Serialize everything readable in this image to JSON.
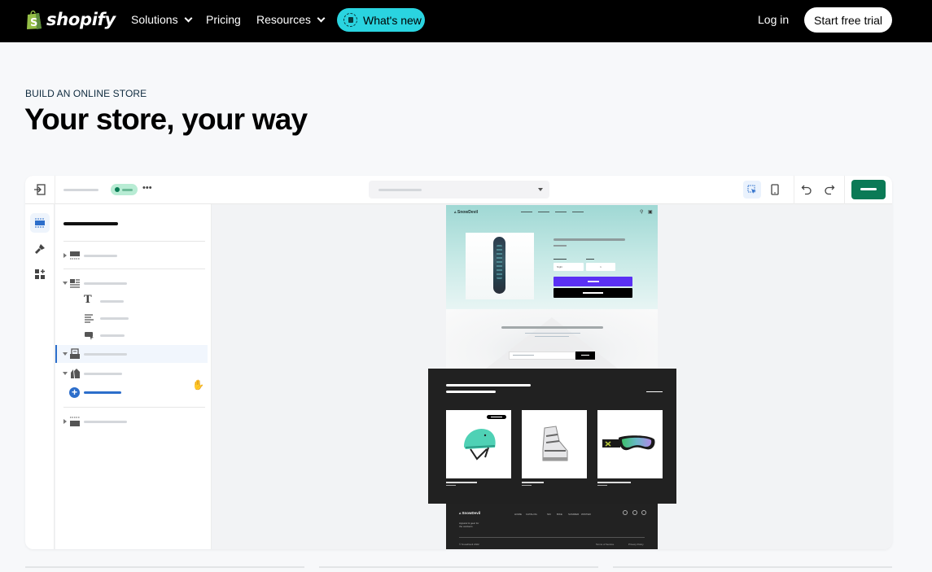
{
  "nav": {
    "brand": "shopify",
    "items": [
      {
        "label": "Solutions",
        "has_dropdown": true
      },
      {
        "label": "Pricing",
        "has_dropdown": false
      },
      {
        "label": "Resources",
        "has_dropdown": true
      }
    ],
    "whats_new": "What's new",
    "login": "Log in",
    "cta": "Start free trial"
  },
  "hero": {
    "eyebrow": "BUILD AN ONLINE STORE",
    "headline": "Your store, your way"
  },
  "editor": {
    "topbar": {
      "icons": [
        "exit-icon",
        "more-icon",
        "select-dropdown-icon",
        "inspector-icon",
        "mobile-preview-icon",
        "undo-icon",
        "redo-icon"
      ],
      "save_color": "#0b7a56"
    },
    "iconbar": [
      "sections-icon",
      "theme-settings-icon",
      "app-blocks-icon"
    ],
    "tree": [
      {
        "type": "header",
        "icon": "header-section-icon",
        "expanded": false
      },
      {
        "type": "image-with-text",
        "icon": "image-text-icon",
        "expanded": true,
        "children": [
          {
            "icon": "heading-icon"
          },
          {
            "icon": "text-icon"
          },
          {
            "icon": "button-icon"
          }
        ]
      },
      {
        "type": "newsletter",
        "icon": "newsletter-icon",
        "expanded": true,
        "selected": true
      },
      {
        "type": "product-list",
        "icon": "product-tags-icon",
        "expanded": true
      },
      {
        "type": "add-section",
        "icon": "add-circle-icon"
      },
      {
        "type": "footer",
        "icon": "footer-section-icon",
        "expanded": false
      }
    ],
    "accent": "#2c6ecb"
  },
  "store_preview": {
    "brand": "SnowDevil",
    "product": {
      "variant": "Night",
      "quantity": "1",
      "buy_button_color": "#5a31f4"
    },
    "collection": {
      "items": [
        "helmet",
        "ski-boot",
        "goggles"
      ]
    },
    "footer": {
      "brand": "SnowDevil",
      "links": [
        "HOME",
        "CATALOG",
        "SKI",
        "BIKE",
        "SUMMER",
        "WINTER"
      ],
      "description": [
        "Apparel & gear for",
        "the outdoors"
      ],
      "copyright": "© SnowDevil 2022",
      "terms": "Terms of Service",
      "privacy": "Privacy Policy"
    }
  }
}
